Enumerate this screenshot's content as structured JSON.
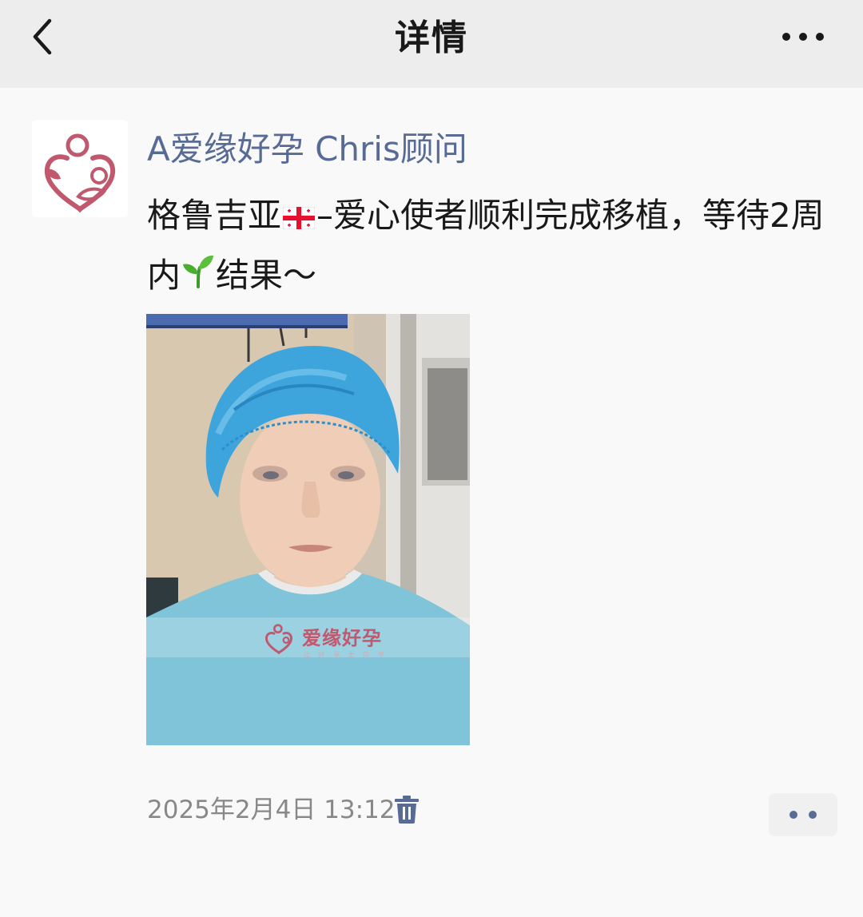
{
  "nav": {
    "title": "详情",
    "back_icon": "chevron-left-icon",
    "more_icon": "more-horizontal-icon"
  },
  "post": {
    "author": "A爱缘好孕 Chris顾问",
    "text_part1": "格鲁吉亚",
    "text_part2": "–爱心使者顺利完成移植，等待2周内",
    "text_part3": "结果～",
    "emoji1": "georgia-flag-icon",
    "emoji2": "seedling-icon",
    "photo_watermark": "爱缘好孕",
    "photo_watermark_sub": "让 好 孕 更 简 单",
    "timestamp": "2025年2月4日 13:12",
    "delete_icon": "trash-icon",
    "comment_icon": "two-dots-icon"
  },
  "colors": {
    "nav_background": "#ededed",
    "page_background": "#f9f9f9",
    "author_link": "#576b95",
    "text": "#191919",
    "timestamp": "#888888",
    "brand_pink": "#c0596e"
  }
}
